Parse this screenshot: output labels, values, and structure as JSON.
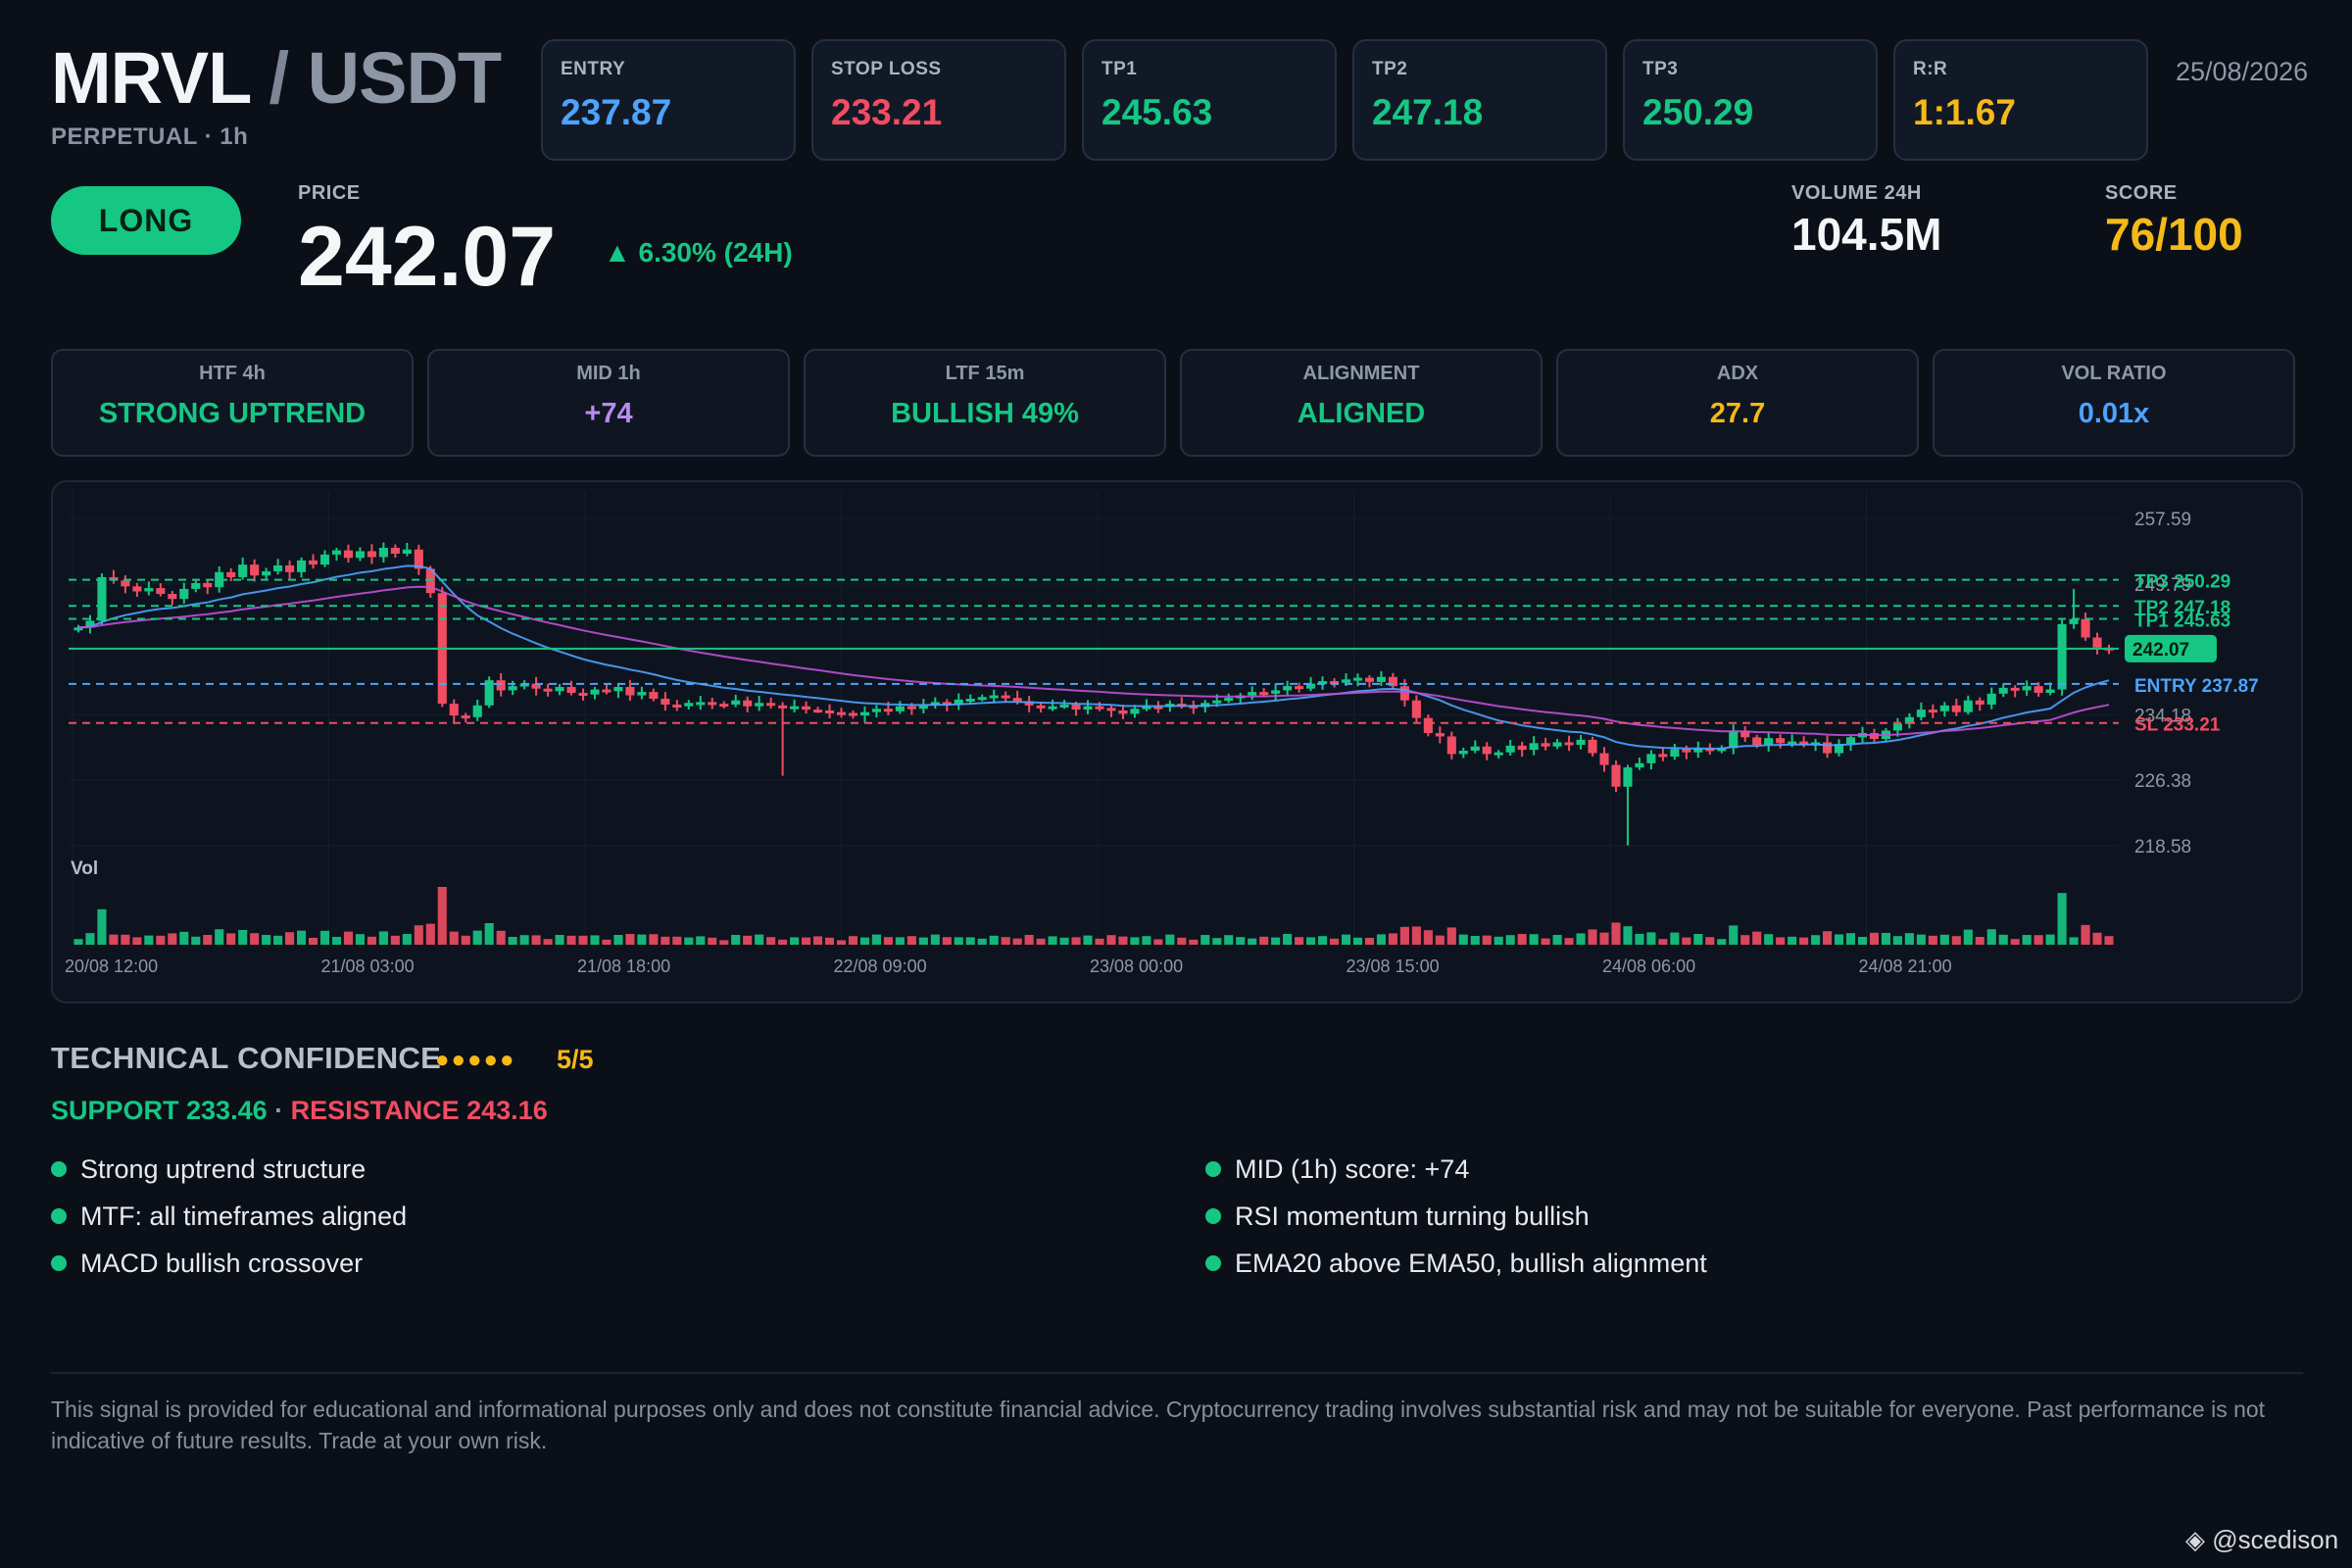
{
  "header": {
    "symbol_base": "MRVL",
    "symbol_sep": " / ",
    "symbol_quote": "USDT",
    "subtitle": "PERPETUAL · 1h",
    "date": "25/08/2026"
  },
  "levels": [
    {
      "label": "ENTRY",
      "value": "237.87",
      "color": "#4da3ff"
    },
    {
      "label": "STOP LOSS",
      "value": "233.21",
      "color": "#f04d63"
    },
    {
      "label": "TP1",
      "value": "245.63",
      "color": "#16c784"
    },
    {
      "label": "TP2",
      "value": "247.18",
      "color": "#16c784"
    },
    {
      "label": "TP3",
      "value": "250.29",
      "color": "#16c784"
    },
    {
      "label": "R:R",
      "value": "1:1.67",
      "color": "#f5b918"
    }
  ],
  "side": "LONG",
  "price": {
    "label": "PRICE",
    "value": "242.07",
    "change": "▲ 6.30% (24H)"
  },
  "volume": {
    "label": "VOLUME 24H",
    "value": "104.5M"
  },
  "score": {
    "label": "SCORE",
    "value": "76/100"
  },
  "mtf": [
    {
      "label": "HTF 4h",
      "value": "STRONG UPTREND",
      "color": "#16c784"
    },
    {
      "label": "MID 1h",
      "value": "+74",
      "color": "#b98cf0"
    },
    {
      "label": "LTF 15m",
      "value": "BULLISH 49%",
      "color": "#16c784"
    },
    {
      "label": "ALIGNMENT",
      "value": "ALIGNED",
      "color": "#16c784"
    },
    {
      "label": "ADX",
      "value": "27.7",
      "color": "#f5b918"
    },
    {
      "label": "VOL RATIO",
      "value": "0.01x",
      "color": "#4da3ff"
    }
  ],
  "chart_data": {
    "type": "candlestick",
    "interval": "1h",
    "y_ticks": [
      "257.59",
      "249.79",
      "241.98",
      "234.18",
      "226.38",
      "218.58"
    ],
    "ylim": [
      214.0,
      261.0
    ],
    "x_ticks": [
      "20/08 12:00",
      "21/08 03:00",
      "21/08 18:00",
      "22/08 09:00",
      "23/08 00:00",
      "23/08 15:00",
      "24/08 06:00",
      "24/08 21:00"
    ],
    "volume_label": "Vol",
    "levels": [
      {
        "name": "TP3",
        "label": "TP3 250.29",
        "value": 250.29,
        "color": "#16c784",
        "style": "dashed"
      },
      {
        "name": "TP2",
        "label": "TP2 247.18",
        "value": 247.18,
        "color": "#16c784",
        "style": "dashed"
      },
      {
        "name": "TP1",
        "label": "TP1 245.63",
        "value": 245.63,
        "color": "#16c784",
        "style": "dashed"
      },
      {
        "name": "price",
        "label": "242.07",
        "value": 242.07,
        "color": "#16c784",
        "style": "solid"
      },
      {
        "name": "ENTRY",
        "label": "ENTRY 237.87",
        "value": 237.87,
        "color": "#4da3ff",
        "style": "dashed"
      },
      {
        "name": "SL",
        "label": "SL 233.21",
        "value": 233.21,
        "color": "#f04d63",
        "style": "dashed"
      }
    ],
    "ema_colors": {
      "fast": "#4da3ff",
      "slow": "#c24fd8"
    },
    "close": [
      244.6,
      245.4,
      250.6,
      250.2,
      249.5,
      248.9,
      249.3,
      248.6,
      248.0,
      249.2,
      249.9,
      249.4,
      251.2,
      250.6,
      252.1,
      250.8,
      251.3,
      252.0,
      251.2,
      252.6,
      252.1,
      253.3,
      253.8,
      252.9,
      253.7,
      253.0,
      254.1,
      253.4,
      253.9,
      251.6,
      248.7,
      235.5,
      234.1,
      233.9,
      235.3,
      238.3,
      237.1,
      237.6,
      237.9,
      237.3,
      237.0,
      237.5,
      236.8,
      236.6,
      237.2,
      237.0,
      237.5,
      236.5,
      236.9,
      236.1,
      235.4,
      235.2,
      235.6,
      235.7,
      235.5,
      235.4,
      235.9,
      235.2,
      235.6,
      235.3,
      235.1,
      235.2,
      234.8,
      234.7,
      234.5,
      234.4,
      234.1,
      234.5,
      234.9,
      234.6,
      235.2,
      234.9,
      235.3,
      235.7,
      235.4,
      236.0,
      236.1,
      236.3,
      236.5,
      236.2,
      235.8,
      235.3,
      235.1,
      235.2,
      235.4,
      234.8,
      235.2,
      235.0,
      234.7,
      234.3,
      234.9,
      235.2,
      235.1,
      235.5,
      235.3,
      235.1,
      235.6,
      235.9,
      236.2,
      236.5,
      236.9,
      236.7,
      237.1,
      237.6,
      237.3,
      237.9,
      238.2,
      238.0,
      238.4,
      238.6,
      238.1,
      238.7,
      237.6,
      235.9,
      233.8,
      232.0,
      231.6,
      229.5,
      229.9,
      230.4,
      229.5,
      229.7,
      230.5,
      230.0,
      230.8,
      230.4,
      230.9,
      230.6,
      231.2,
      229.6,
      228.2,
      225.6,
      227.9,
      228.4,
      229.5,
      229.2,
      230.1,
      229.7,
      230.2,
      229.9,
      230.2,
      232.3,
      231.5,
      230.6,
      231.4,
      230.8,
      231.0,
      230.6,
      230.9,
      229.6,
      230.7,
      231.5,
      232.0,
      231.3,
      232.3,
      233.1,
      233.9,
      234.8,
      234.6,
      235.3,
      234.5,
      235.9,
      235.4,
      236.7,
      237.4,
      237.1,
      237.6,
      236.8,
      237.2,
      245.0,
      245.6,
      243.4,
      242.2,
      242.07
    ]
  },
  "confidence": {
    "title": "TECHNICAL CONFIDENCE",
    "dots": "●●●●●",
    "value": "5/5"
  },
  "sr": {
    "support": "SUPPORT 233.46",
    "sep": " · ",
    "resistance": "RESISTANCE 243.16"
  },
  "reasons_left": [
    "Strong uptrend structure",
    "MTF: all timeframes aligned",
    "MACD bullish crossover"
  ],
  "reasons_right": [
    "MID (1h) score: +74",
    "RSI momentum turning bullish",
    "EMA20 above EMA50, bullish alignment"
  ],
  "disclaimer": "This signal is provided for educational and informational purposes only and does not constitute financial advice. Cryptocurrency trading involves substantial risk and may not be suitable for everyone. Past performance is not indicative of future results. Trade at your own risk.",
  "watermark": "@scedison",
  "colors": {
    "bull": "#16c784",
    "bear": "#f04d63",
    "accent": "#f5b918",
    "background": "#0b1018"
  }
}
